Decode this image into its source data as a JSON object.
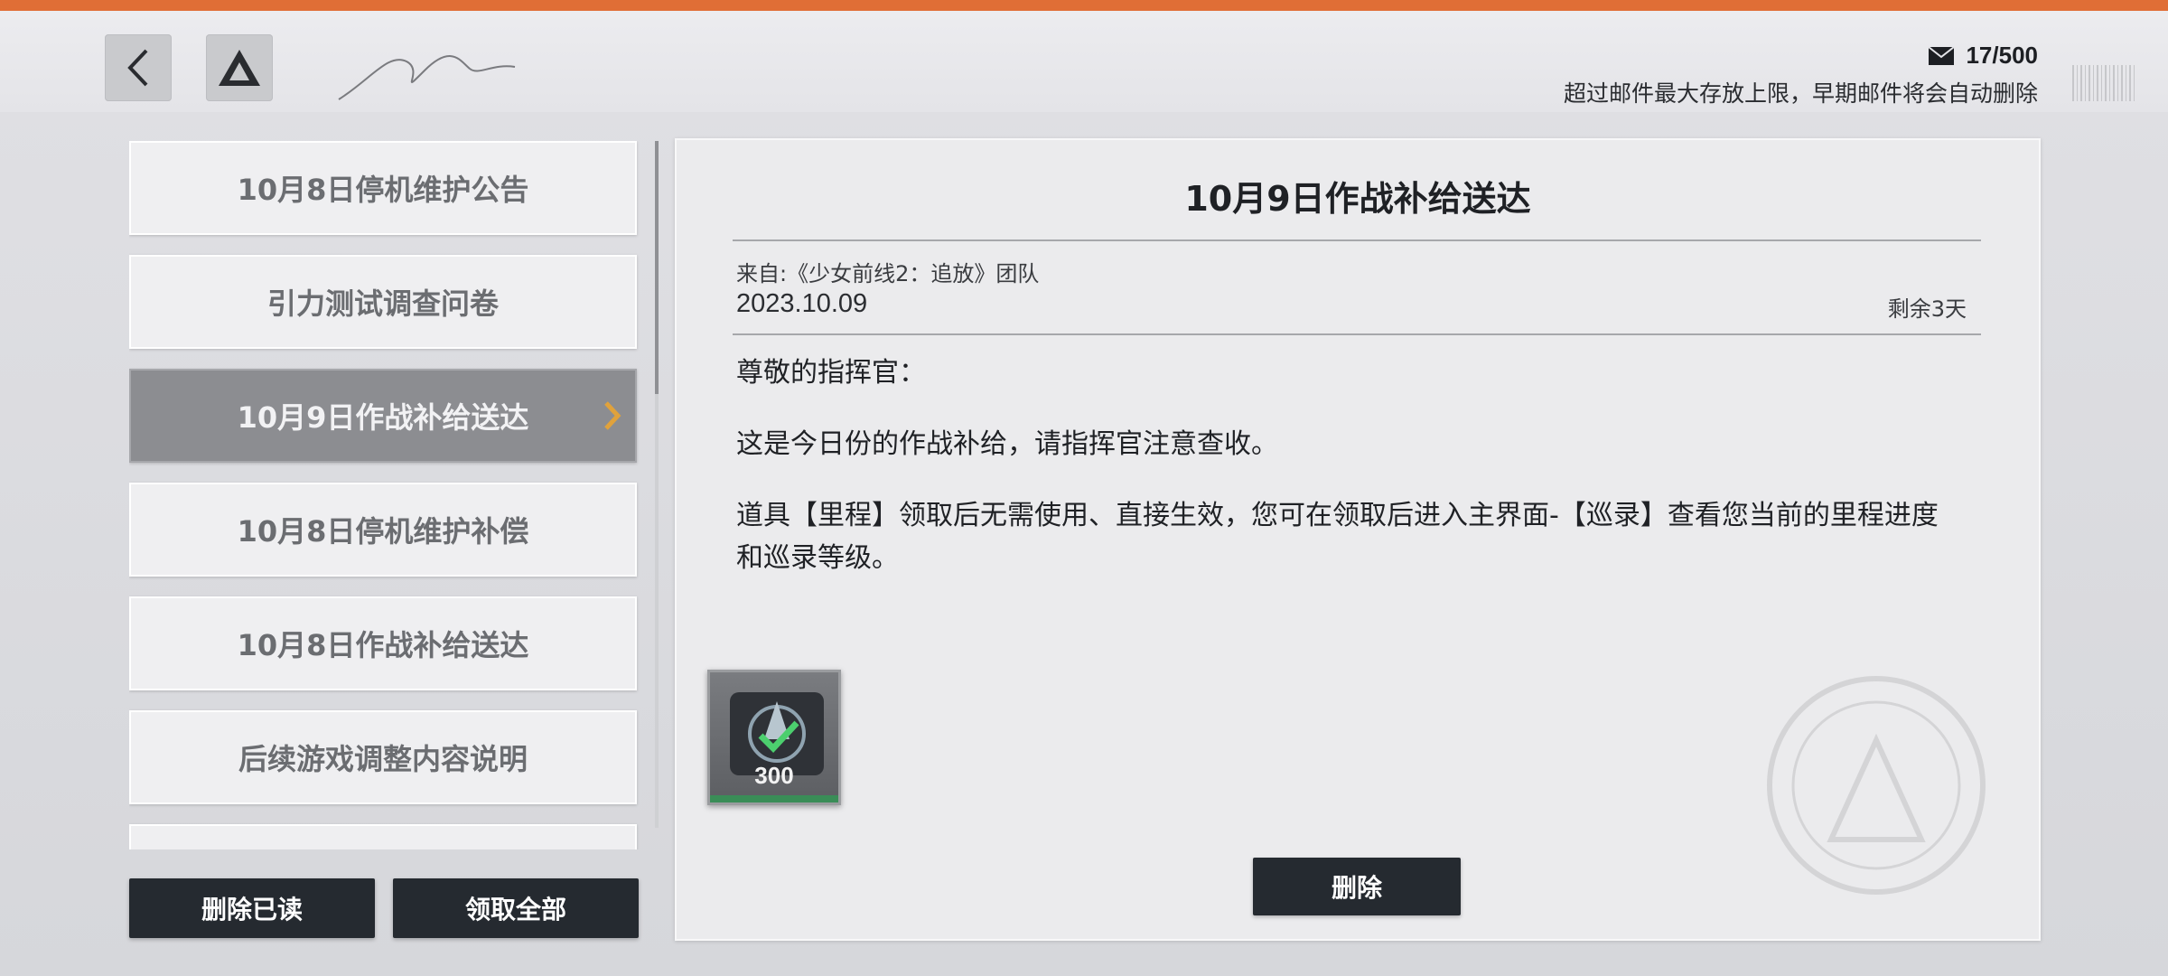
{
  "header": {
    "back_icon": "chevron-left-icon",
    "app_icon": "triangle-logo-icon",
    "mail_icon": "envelope-icon",
    "mail_count": "17/500",
    "notice": "超过邮件最大存放上限，早期邮件将会自动删除"
  },
  "mail_list": [
    {
      "title": "10月8日停机维护公告",
      "selected": false
    },
    {
      "title": "引力测试调查问卷",
      "selected": false
    },
    {
      "title": "10月9日作战补给送达",
      "selected": true
    },
    {
      "title": "10月8日停机维护补偿",
      "selected": false
    },
    {
      "title": "10月8日作战补给送达",
      "selected": false
    },
    {
      "title": "后续游戏调整内容说明",
      "selected": false
    }
  ],
  "actions": {
    "delete_read": "删除已读",
    "claim_all": "领取全部"
  },
  "detail": {
    "title": "10月9日作战补给送达",
    "from": "来自:《少女前线2：追放》团队",
    "date": "2023.10.09",
    "remaining": "剩余3天",
    "greeting": "尊敬的指挥官：",
    "paragraph1": "这是今日份的作战补给，请指挥官注意查收。",
    "paragraph2": "道具【里程】领取后无需使用、直接生效，您可在领取后进入主界面-【巡录】查看您当前的里程进度和巡录等级。",
    "reward": {
      "icon": "mileage-check-icon",
      "count": "300"
    },
    "delete_label": "删除"
  },
  "colors": {
    "accent_orange": "#e06e36",
    "dark_button": "#252a30",
    "selected_item": "#8c8d91",
    "chevron_gold": "#e0a23c"
  }
}
